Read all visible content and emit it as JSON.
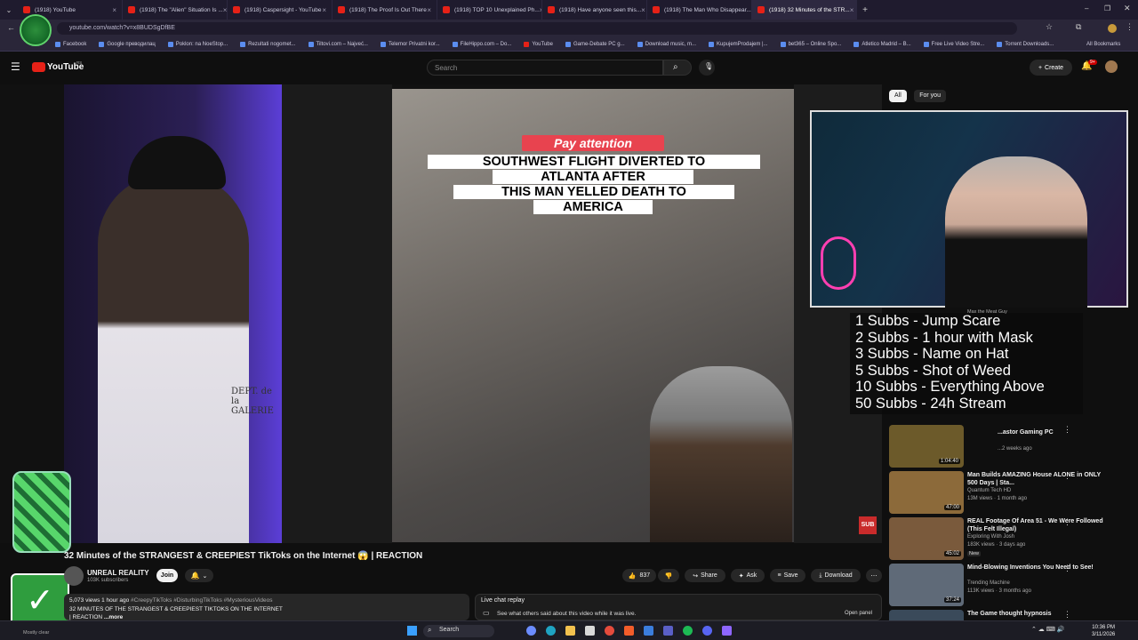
{
  "browser": {
    "tabs": [
      {
        "label": "(1918) YouTube"
      },
      {
        "label": "(1918) The \"Alien\" Situation Is ..."
      },
      {
        "label": "(1918) Caspersight - YouTube"
      },
      {
        "label": "(1918) The Proof Is Out There"
      },
      {
        "label": "(1918) TOP 10 Unexplained Ph..."
      },
      {
        "label": "(1918) Have anyone seen this..."
      },
      {
        "label": "(1918) The Man Who Disappear..."
      },
      {
        "label": "(1918) 32 Minutes of the STR..."
      }
    ],
    "url": "youtube.com/watch?v=x8BUDSgDfBE",
    "bookmarks": [
      "Facebook",
      "Google преводилац",
      "Poklon: na NoeStop...",
      "Rezultati nogomet...",
      "Tiltovi.com – Najveć...",
      "Telemor Privatni kor...",
      "FileHippo.com – Do...",
      "YouTube",
      "Game-Debate PC g...",
      "Download music, m...",
      "KupujemProdajem |...",
      "bet365 – Online Spo...",
      "Atletico Madrid – B...",
      "Free Live Video Stre...",
      "Torrent Downloads..."
    ],
    "all_bookmarks": "All Bookmarks"
  },
  "youtube": {
    "logo": "YouTube",
    "logo_sup": "RS",
    "search_placeholder": "Search",
    "create_label": "Create",
    "notif_count": "9+"
  },
  "video": {
    "overlay_badge": "Pay attention",
    "caption_lines": [
      "SOUTHWEST FLIGHT DIVERTED TO",
      "ATLANTA AFTER",
      "THIS MAN YELLED DEATH TO",
      "AMERICA"
    ],
    "shirt_text": "DEPT. de la GALERIE",
    "sub_badge": "SUB",
    "subb_goals": [
      "1 Subbs - Jump Scare",
      "2 Subbs - 1 hour with Mask",
      "3 Subbs - Name on Hat",
      "5 Subbs - Shot of Weed",
      "10 Subbs - Everything Above",
      "50 Subbs - 24h Stream"
    ]
  },
  "sidebar": {
    "chips": [
      "All",
      "For you"
    ],
    "recommendations": [
      {
        "title": "Man Builds AMAZING House ALONE in ONLY 500 Days | Sta...",
        "channel": "Quantum Tech HD",
        "meta": "13M views · 1 month ago",
        "duration": "47:00",
        "thumb": "#8c6a3a"
      },
      {
        "title": "REAL Footage Of Area 51 - We Were Followed (This Felt Illegal)",
        "channel": "Exploring With Josh",
        "meta": "183K views · 3 days ago",
        "duration": "45:02",
        "thumb": "#7a5a3c",
        "badge": "New"
      },
      {
        "title": "Mind-Blowing Inventions You Need to See!",
        "channel": "Trending Machine",
        "meta": "113K views · 3 months ago",
        "duration": "37:24",
        "thumb": "#5f6a78"
      },
      {
        "title": "The Game thought hypnosis",
        "channel": "",
        "meta": "",
        "duration": "",
        "thumb": "#3a4a5a"
      }
    ],
    "partial_items": [
      {
        "title": "...astor Gaming PC",
        "meta": "...2 weeks ago",
        "duration": "1:04:40"
      },
      {
        "channel": "Max the Meat Guy"
      }
    ]
  },
  "watch": {
    "title": "32 Minutes of the STRANGEST & CREEPIEST TikToks on the Internet 😱 | REACTION",
    "channel": "UNREAL REALITY",
    "subscribers": "103K subscribers",
    "join_label": "Join",
    "likes": "837",
    "share_label": "Share",
    "ask_label": "Ask",
    "save_label": "Save",
    "download_label": "Download",
    "desc_stats": "5,073 views  1 hour ago",
    "desc_tags": "#CreepyTikToks #DisturbingTikToks #MysteriousVideos",
    "desc_line2": "32 MINUTES OF THE STRANGEST & CREEPIEST TIKTOKS ON THE INTERNET",
    "desc_line3": "| REACTION",
    "desc_more": "...more",
    "livechat_title": "Live chat replay",
    "livechat_sub": "See what others said about this video while it was live.",
    "livechat_open": "Open panel"
  },
  "taskbar": {
    "search_label": "Search",
    "weather": "Mostly clear",
    "time": "10:36 PM",
    "date": "3/11/2026"
  },
  "colors": {
    "accent": "#e62117",
    "bg": "#0f0f0f"
  }
}
